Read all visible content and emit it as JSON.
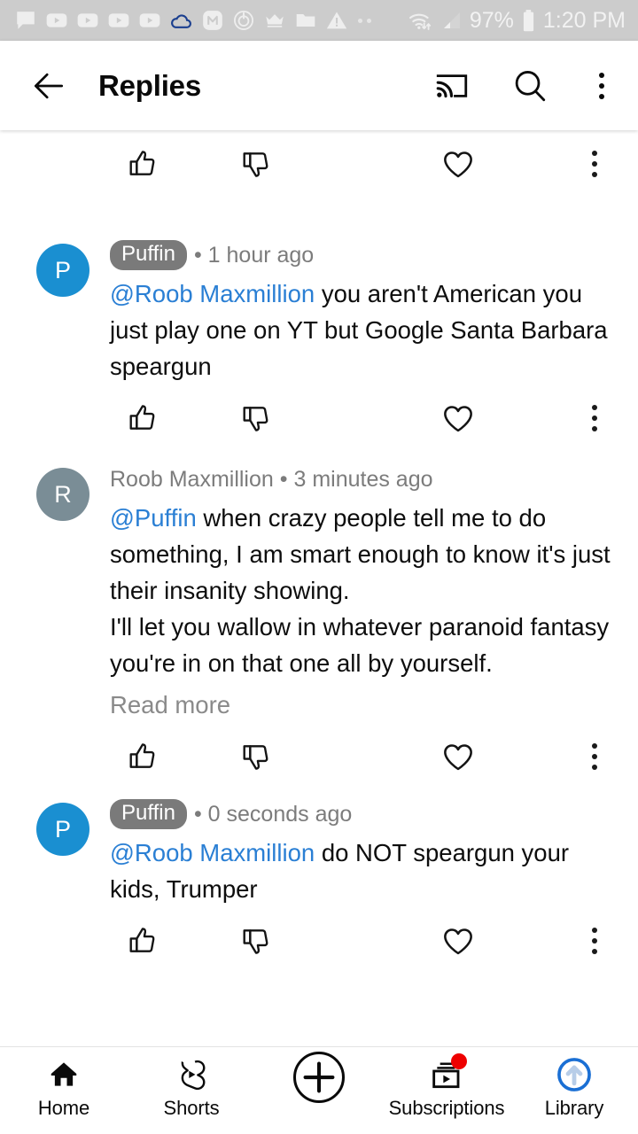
{
  "status_bar": {
    "battery_percent": "97%",
    "time": "1:20 PM",
    "icons": [
      "chat-bubble-icon",
      "youtube-play-icon",
      "youtube-play-icon",
      "youtube-play-icon",
      "youtube-play-icon",
      "cloud-icon",
      "m-circle-icon",
      "power-timer-icon",
      "crown-icon",
      "folder-icon",
      "warning-triangle-icon",
      "more-dots-icon"
    ],
    "right_icons": [
      "wifi-transfer-icon",
      "cellular-signal-icon",
      "battery-icon"
    ],
    "background": "#cccccc",
    "foreground": "#f0f0f0",
    "cloud_color": "#1b3f8f"
  },
  "app_bar": {
    "title": "Replies",
    "back_icon": "back-arrow-icon",
    "cast_icon": "cast-icon",
    "search_icon": "search-icon",
    "overflow_icon": "kebab-menu-icon"
  },
  "actions": {
    "like": "thumbs-up-icon",
    "dislike": "thumbs-down-icon",
    "heart": "heart-icon",
    "more": "kebab-menu-icon"
  },
  "comments": [
    {
      "id": "partial-top",
      "partial": true
    },
    {
      "id": "comment-puffin-1",
      "avatar_letter": "P",
      "avatar_color": "#1a8fd1",
      "badge": "Puffin",
      "has_badge": true,
      "separator": "•",
      "timestamp": "1 hour ago",
      "mention": "@Roob Maxmillion",
      "text": " you aren't American you just play one on YT but Google Santa Barbara speargun",
      "read_more": ""
    },
    {
      "id": "comment-roob-1",
      "avatar_letter": "R",
      "avatar_color": "#7a8d96",
      "author": "Roob Maxmillion",
      "has_badge": false,
      "separator": "•",
      "timestamp": "3 minutes ago",
      "mention": "@Puffin",
      "text": " when crazy people tell me to do something, I am smart enough to know it's just their insanity showing.\nI'll let you wallow in whatever paranoid fantasy you're in on that one all by yourself.",
      "read_more": "Read more"
    },
    {
      "id": "comment-puffin-2",
      "avatar_letter": "P",
      "avatar_color": "#1a8fd1",
      "badge": "Puffin",
      "has_badge": true,
      "separator": "•",
      "timestamp": "0 seconds ago",
      "mention": "@Roob Maxmillion",
      "text": " do NOT speargun your kids, Trumper",
      "read_more": ""
    }
  ],
  "bottom_nav": {
    "items": [
      {
        "label": "Home",
        "icon": "home-icon",
        "badge": false
      },
      {
        "label": "Shorts",
        "icon": "shorts-icon",
        "badge": false
      },
      {
        "label": "",
        "icon": "create-plus-icon",
        "badge": false
      },
      {
        "label": "Subscriptions",
        "icon": "subscriptions-icon",
        "badge": true
      },
      {
        "label": "Library",
        "icon": "library-icon",
        "badge": false
      }
    ],
    "badge_color": "#ee0000",
    "library_accent": "#1a6fd4"
  },
  "colors": {
    "mention_blue": "#2a7fd4",
    "meta_gray": "#7c7c7c",
    "text_black": "#0d0d0d",
    "badge_gray": "#7a7a7a"
  }
}
